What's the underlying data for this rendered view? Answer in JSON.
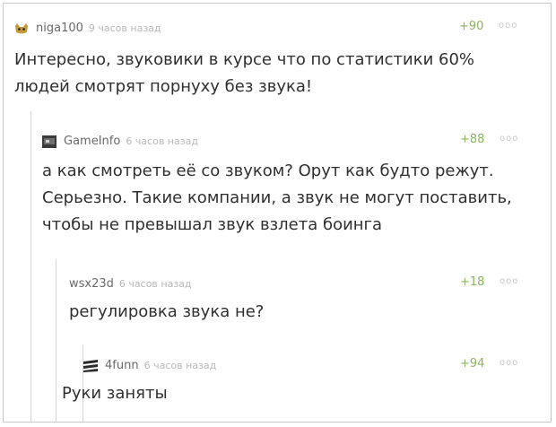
{
  "comments": [
    {
      "author": "niga100",
      "time": "9 часов назад",
      "rating": "+90",
      "menu": "ooo",
      "lines": [
        "Интересно, звуковики в курсе что по статистики 60%",
        "людей смотрят порнуху без звука!"
      ]
    },
    {
      "author": "GameInfo",
      "time": "6 часов назад",
      "rating": "+88",
      "menu": "ooo",
      "lines": [
        "а как смотреть её со звуком? Орут как будто режут.",
        "Серьезно. Такие компании, а звук не могут поставить,",
        "чтобы не превышал звук взлета боинга"
      ]
    },
    {
      "author": "wsx23d",
      "time": "6 часов назад",
      "rating": "+18",
      "menu": "ooo",
      "lines": [
        "регулировка звука не?"
      ]
    },
    {
      "author": "4funn",
      "time": "6 часов назад",
      "rating": "+94",
      "menu": "ooo",
      "lines": [
        "Руки заняты"
      ]
    }
  ],
  "colors": {
    "rating": "#8bb55f",
    "author": "#6a6a6a",
    "time": "#b8b8b8",
    "text": "#2f2f2f"
  }
}
